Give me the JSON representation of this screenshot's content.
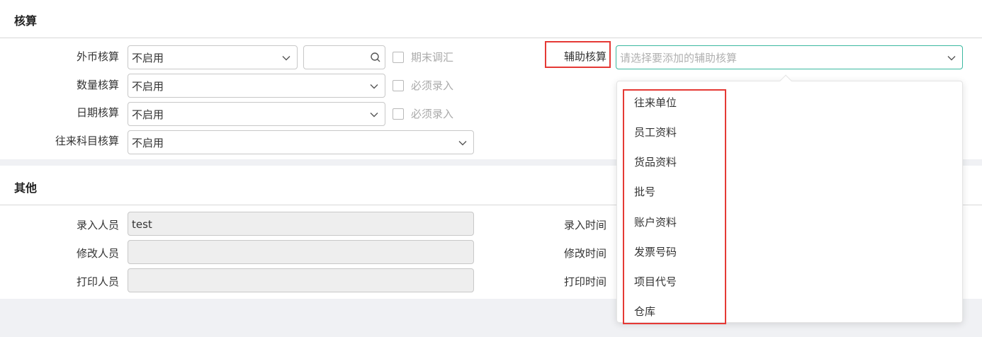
{
  "accounting": {
    "title": "核算",
    "foreign_currency": {
      "label": "外币核算",
      "value": "不启用",
      "checkbox_label": "期末调汇"
    },
    "quantity": {
      "label": "数量核算",
      "value": "不启用",
      "checkbox_label": "必须录入"
    },
    "date": {
      "label": "日期核算",
      "value": "不启用",
      "checkbox_label": "必须录入"
    },
    "counterparty": {
      "label": "往来科目核算",
      "value": "不启用"
    },
    "auxiliary": {
      "label": "辅助核算",
      "placeholder": "请选择要添加的辅助核算"
    }
  },
  "dropdown": {
    "items": [
      "往来单位",
      "员工资料",
      "货品资料",
      "批号",
      "账户资料",
      "发票号码",
      "项目代号",
      "仓库"
    ]
  },
  "other": {
    "title": "其他",
    "entered_by": {
      "label": "录入人员",
      "value": "test"
    },
    "modified_by": {
      "label": "修改人员",
      "value": ""
    },
    "printed_by": {
      "label": "打印人员",
      "value": ""
    },
    "entered_time": {
      "label": "录入时间"
    },
    "modified_time": {
      "label": "修改时间"
    },
    "printed_time": {
      "label": "打印时间"
    }
  },
  "colors": {
    "focus": "#3bb8a0",
    "highlight": "#e53935"
  }
}
